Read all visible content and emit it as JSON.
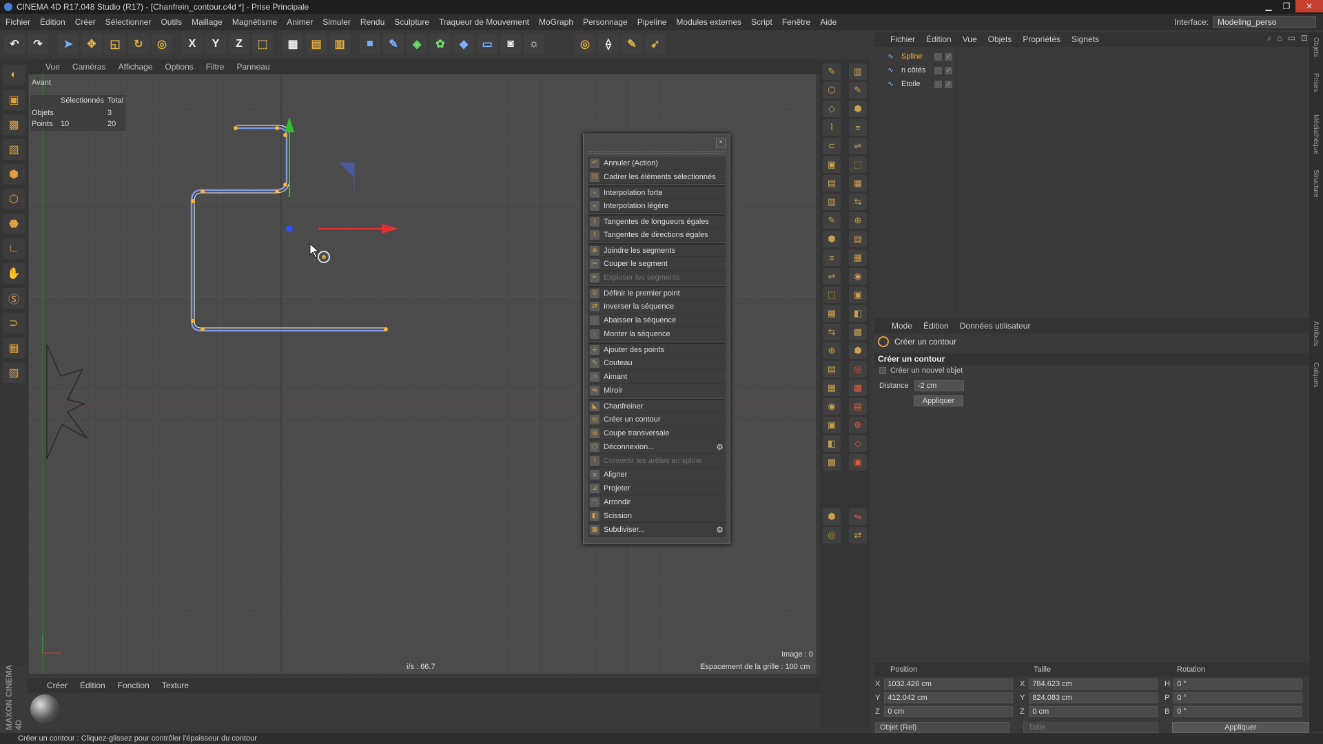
{
  "window": {
    "title": "CINEMA 4D R17.048 Studio (R17) - [Chanfrein_contour.c4d *] - Prise Principale",
    "min": "▁",
    "max": "❐",
    "close": "✕"
  },
  "menubar": {
    "items": [
      "Fichier",
      "Édition",
      "Créer",
      "Sélectionner",
      "Outils",
      "Maillage",
      "Magnétisme",
      "Animer",
      "Simuler",
      "Rendu",
      "Sculpture",
      "Traqueur de Mouvement",
      "MoGraph",
      "Personnage",
      "Pipeline",
      "Modules externes",
      "Script",
      "Fenêtre",
      "Aide"
    ],
    "interface_label": "Interface:",
    "interface_value": "Modeling_perso"
  },
  "toolbar": {
    "axis_x": "X",
    "axis_y": "Y",
    "axis_z": "Z"
  },
  "viewport": {
    "menu": [
      "Vue",
      "Caméras",
      "Affichage",
      "Options",
      "Filtre",
      "Panneau"
    ],
    "view_name": "Avant",
    "stats": {
      "header_selected": "Sélectionnés",
      "header_total": "Total",
      "objects_label": "Objets",
      "objects_selected": "",
      "objects_total": "3",
      "points_label": "Points",
      "points_selected": "10",
      "points_total": "20"
    },
    "fps": "i/s : 66.7",
    "grid_spacing": "Espacement de la grille : 100 cm",
    "image": "Image : 0"
  },
  "popup_menu": {
    "close": "×",
    "items": [
      {
        "label": "Annuler (Action)",
        "enabled": true,
        "gap": false,
        "gear": false
      },
      {
        "label": "Cadrer les éléments sélectionnés",
        "enabled": true,
        "gap": false,
        "gear": false
      },
      {
        "label": "Interpolation forte",
        "enabled": true,
        "gap": true,
        "gear": false
      },
      {
        "label": "Interpolation légère",
        "enabled": true,
        "gap": false,
        "gear": false
      },
      {
        "label": "Tangentes de longueurs égales",
        "enabled": true,
        "gap": true,
        "gear": false
      },
      {
        "label": "Tangentes de directions égales",
        "enabled": true,
        "gap": false,
        "gear": false
      },
      {
        "label": "Joindre les segments",
        "enabled": true,
        "gap": true,
        "gear": false
      },
      {
        "label": "Couper le segment",
        "enabled": true,
        "gap": false,
        "gear": false
      },
      {
        "label": "Exploser les segments",
        "enabled": false,
        "gap": false,
        "gear": false
      },
      {
        "label": "Définir le premier point",
        "enabled": true,
        "gap": true,
        "gear": false
      },
      {
        "label": "Inverser la séquence",
        "enabled": true,
        "gap": false,
        "gear": false
      },
      {
        "label": "Abaisser la séquence",
        "enabled": true,
        "gap": false,
        "gear": false
      },
      {
        "label": "Monter la séquence",
        "enabled": true,
        "gap": false,
        "gear": false
      },
      {
        "label": "Ajouter des points",
        "enabled": true,
        "gap": true,
        "gear": false
      },
      {
        "label": "Couteau",
        "enabled": true,
        "gap": false,
        "gear": false
      },
      {
        "label": "Aimant",
        "enabled": true,
        "gap": false,
        "gear": false
      },
      {
        "label": "Miroir",
        "enabled": true,
        "gap": false,
        "gear": false
      },
      {
        "label": "Chanfreiner",
        "enabled": true,
        "gap": true,
        "gear": false
      },
      {
        "label": "Créer un contour",
        "enabled": true,
        "gap": false,
        "gear": false
      },
      {
        "label": "Coupe transversale",
        "enabled": true,
        "gap": false,
        "gear": false
      },
      {
        "label": "Déconnexion...",
        "enabled": true,
        "gap": false,
        "gear": true
      },
      {
        "label": "Convertir les arêtes en spline",
        "enabled": false,
        "gap": false,
        "gear": false
      },
      {
        "label": "Aligner",
        "enabled": true,
        "gap": false,
        "gear": false
      },
      {
        "label": "Projeter",
        "enabled": true,
        "gap": false,
        "gear": false
      },
      {
        "label": "Arrondir",
        "enabled": true,
        "gap": false,
        "gear": false
      },
      {
        "label": "Scission",
        "enabled": true,
        "gap": false,
        "gear": false
      },
      {
        "label": "Subdiviser...",
        "enabled": true,
        "gap": false,
        "gear": true
      }
    ]
  },
  "object_manager": {
    "menu": [
      "Fichier",
      "Édition",
      "Vue",
      "Objets",
      "Propriétés",
      "Signets"
    ],
    "objects": [
      {
        "name": "Spline",
        "selected": true
      },
      {
        "name": "n côtés",
        "selected": false
      },
      {
        "name": "Etoile",
        "selected": false
      }
    ]
  },
  "attributes": {
    "menu": [
      "Mode",
      "Édition",
      "Données utilisateur"
    ],
    "tool_title": "Créer un contour",
    "section": "Créer un contour",
    "new_object_label": "Créer un nouvel objet",
    "distance_label": "Distance",
    "distance_value": "-2 cm",
    "apply_label": "Appliquer"
  },
  "coordinates": {
    "headers": [
      "Position",
      "Taille",
      "Rotation"
    ],
    "rows": [
      {
        "pos_axis": "X",
        "pos": "1032.426 cm",
        "size_axis": "X",
        "size": "784.623 cm",
        "rot_axis": "H",
        "rot": "0 °"
      },
      {
        "pos_axis": "Y",
        "pos": "412.042 cm",
        "size_axis": "Y",
        "size": "824.083 cm",
        "rot_axis": "P",
        "rot": "0 °"
      },
      {
        "pos_axis": "Z",
        "pos": "0 cm",
        "size_axis": "Z",
        "size": "0 cm",
        "rot_axis": "B",
        "rot": "0 °"
      }
    ],
    "mode": "Objet (Rel)",
    "size_mode": "Taille",
    "apply": "Appliquer"
  },
  "material_manager": {
    "menu": [
      "Créer",
      "Édition",
      "Fonction",
      "Texture"
    ]
  },
  "brand": "MAXON CINEMA 4D",
  "right_tabs": [
    "Objets",
    "Prises",
    "Médiathèque",
    "Structure",
    "Attributs",
    "Calques"
  ],
  "status": "Créer un contour : Cliquez-glissez pour contrôler l'épaisseur du contour",
  "colors": {
    "accent": "#e0a040",
    "spline": "#7d96e8",
    "point": "#ffb030",
    "axis_x": "#e83030",
    "axis_y": "#30c030",
    "axis_z": "#3050ff"
  }
}
